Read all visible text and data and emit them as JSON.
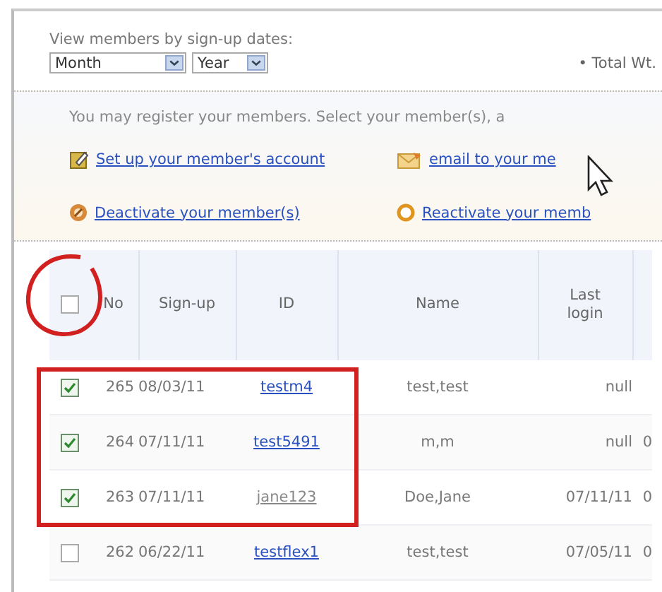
{
  "filter": {
    "label": "View members by sign-up dates:",
    "month": "Month",
    "year": "Year",
    "total": "• Total Wt."
  },
  "panel": {
    "intro": "You may register your members. Select your member(s), a",
    "actions": [
      {
        "kind": "account",
        "label": "Set up your member's account"
      },
      {
        "kind": "email",
        "label": "email to your me"
      },
      {
        "kind": "deactivate",
        "label": "Deactivate your member(s)"
      },
      {
        "kind": "reactivate",
        "label": "Reactivate your memb"
      }
    ]
  },
  "table": {
    "columns": [
      "No",
      "Sign-up",
      "ID",
      "Name",
      "Last login"
    ],
    "all_checked": false,
    "rows": [
      {
        "checked": true,
        "no": "265",
        "signup": "08/03/11",
        "id": "testm4",
        "visited": false,
        "name": "test,test",
        "last_login": "null"
      },
      {
        "checked": true,
        "no": "264",
        "signup": "07/11/11",
        "id": "test5491",
        "visited": false,
        "name": "m,m",
        "last_login": "null",
        "column_7": "0"
      },
      {
        "checked": true,
        "no": "263",
        "signup": "07/11/11",
        "id": "jane123",
        "visited": true,
        "name": "Doe,Jane",
        "last_login": "07/11/11",
        "column_7": "0"
      },
      {
        "checked": false,
        "no": "262",
        "signup": "06/22/11",
        "id": "testflex1",
        "visited": false,
        "name": "test,test",
        "last_login": "07/05/11",
        "column_7": "0"
      }
    ]
  },
  "annotations": [
    {
      "kind": "circle"
    },
    {
      "kind": "rectangle"
    }
  ]
}
